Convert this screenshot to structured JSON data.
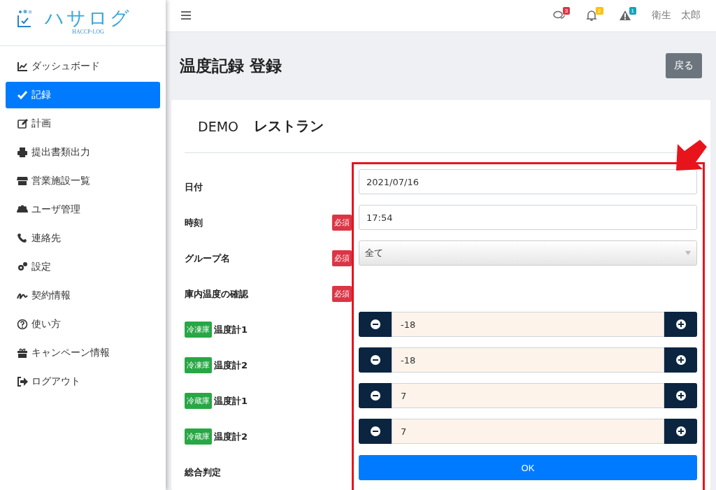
{
  "logo": {
    "title": "ハサログ",
    "subtitle": "HACCP-LOG"
  },
  "sidebar": {
    "items": [
      {
        "label": "ダッシュボード",
        "selected": false
      },
      {
        "label": "記録",
        "selected": true
      },
      {
        "label": "計画",
        "selected": false
      },
      {
        "label": "提出書類出力",
        "selected": false
      },
      {
        "label": "営業施設一覧",
        "selected": false
      },
      {
        "label": "ユーザ管理",
        "selected": false
      },
      {
        "label": "連絡先",
        "selected": false
      },
      {
        "label": "設定",
        "selected": false
      },
      {
        "label": "契約情報",
        "selected": false
      },
      {
        "label": "使い方",
        "selected": false
      },
      {
        "label": "キャンペーン情報",
        "selected": false
      },
      {
        "label": "ログアウト",
        "selected": false
      }
    ]
  },
  "header": {
    "notifications": [
      {
        "kind": "messages",
        "count": "3",
        "color": "#dc3545"
      },
      {
        "kind": "alerts",
        "count": "2",
        "color": "#ffc107"
      },
      {
        "kind": "warnings",
        "count": "1",
        "color": "#17a2b8"
      }
    ],
    "user": "衛生　太郎"
  },
  "page": {
    "title": "温度記録 登録",
    "back_button": "戻る"
  },
  "card": {
    "facility_code": "DEMO",
    "facility_name": "レストラン",
    "rows": [
      {
        "kind": "input",
        "label": "日付",
        "required": false,
        "value": "2021/07/16"
      },
      {
        "kind": "input",
        "label": "時刻",
        "required": true,
        "required_label": "必須",
        "value": "17:54"
      },
      {
        "kind": "select",
        "label": "グループ名",
        "required": true,
        "required_label": "必須",
        "value": "全て"
      },
      {
        "kind": "heading",
        "label": "庫内温度の確認",
        "required": true,
        "required_label": "必須"
      },
      {
        "kind": "stepper",
        "tag": "冷凍庫",
        "label": "温度計1",
        "required": false,
        "value": "-18"
      },
      {
        "kind": "stepper",
        "tag": "冷凍庫",
        "label": "温度計2",
        "required": false,
        "value": "-18"
      },
      {
        "kind": "stepper",
        "tag": "冷蔵庫",
        "label": "温度計1",
        "required": false,
        "value": "7"
      },
      {
        "kind": "stepper",
        "tag": "冷蔵庫",
        "label": "温度計2",
        "required": false,
        "value": "7"
      },
      {
        "kind": "button",
        "label": "総合判定",
        "required": false,
        "value": "OK"
      }
    ]
  }
}
